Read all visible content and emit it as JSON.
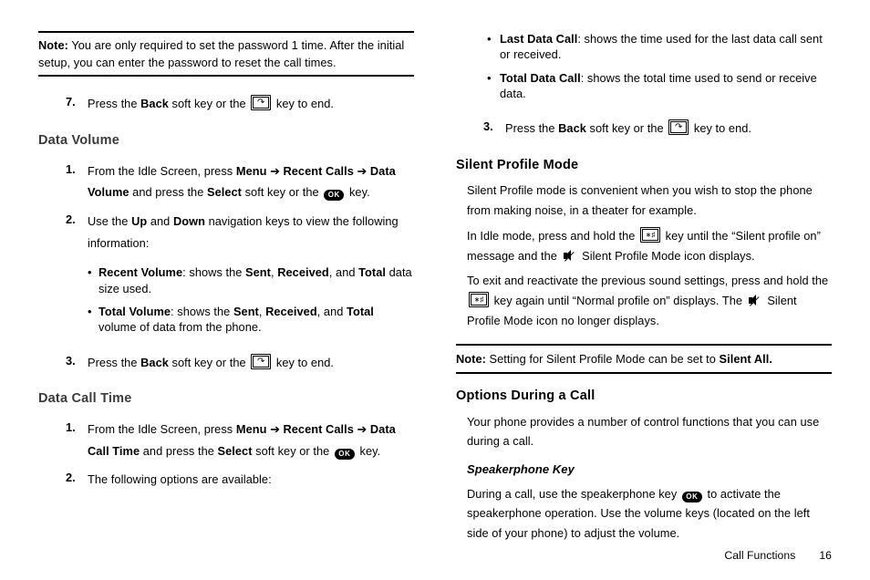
{
  "left": {
    "note1": {
      "label": "Note:",
      "text": " You are only required to set the password 1 time. After the initial setup, you can enter the password to reset the call times."
    },
    "step7": {
      "pre": "Press the ",
      "back": "Back",
      "mid": " soft key or the ",
      "post": " key to end."
    },
    "dataVolume": {
      "heading": "Data Volume",
      "s1": {
        "pre": "From the Idle Screen, press ",
        "menu": "Menu",
        "arrow1": " ➔ ",
        "recent": "Recent Calls",
        "arrow2": " ➔ ",
        "dv": "Data Volume",
        "mid": " and press the ",
        "select": "Select",
        "mid2": " soft key or the ",
        "post": " key."
      },
      "s2": {
        "pre": "Use the ",
        "up": "Up",
        "and": " and ",
        "down": "Down",
        "post": " navigation keys to view the following information:"
      },
      "b1": {
        "t": "Recent Volume",
        "rest_a": ": shows the ",
        "sent": "Sent",
        "c1": ", ",
        "rcvd": "Received",
        "c2": ", and ",
        "total": "Total",
        "rest_b": " data size used."
      },
      "b2": {
        "t": "Total Volume",
        "rest_a": ": shows the ",
        "sent": "Sent",
        "c1": ", ",
        "rcvd": "Received",
        "c2": ", and ",
        "total": "Total",
        "rest_b": " volume of data from the phone."
      },
      "s3": {
        "pre": "Press the ",
        "back": "Back",
        "mid": " soft key or the ",
        "post": " key to end."
      }
    },
    "dataCallTime": {
      "heading": "Data Call Time",
      "s1": {
        "pre": "From the Idle Screen, press ",
        "menu": "Menu",
        "arrow1": " ➔ ",
        "recent": "Recent Calls",
        "arrow2": " ➔ ",
        "dct": "Data Call Time",
        "mid": " and press the ",
        "select": "Select",
        "mid2": " soft key or the ",
        "post": " key."
      },
      "s2": "The following options are available:"
    }
  },
  "right": {
    "b1": {
      "t": "Last Data Call",
      "rest": ": shows the time used for the last data call sent or received."
    },
    "b2": {
      "t": "Total Data Call",
      "rest": ": shows the total time used to send or receive data."
    },
    "s3": {
      "pre": "Press the ",
      "back": "Back",
      "mid": " soft key or the ",
      "post": " key to end."
    },
    "silent": {
      "heading": "Silent Profile Mode",
      "p1": "Silent Profile mode is convenient when you wish to stop the phone from making noise, in a theater for example.",
      "p2a": "In Idle mode, press and hold the ",
      "p2b": " key until the “Silent profile on” message and the ",
      "p2c": " Silent Profile Mode icon displays.",
      "p3a": "To exit and reactivate the previous sound settings, press and hold the ",
      "p3b": " key again until “Normal profile on” displays. The ",
      "p3c": " Silent Profile Mode icon no longer displays."
    },
    "note2": {
      "label": "Note:",
      "pre": " Setting for Silent Profile Mode can be set to ",
      "b": "Silent All."
    },
    "options": {
      "heading": "Options During a Call",
      "p1": "Your phone provides a number of control functions that you can use during a call.",
      "sub": "Speakerphone Key",
      "p2a": "During a call, use the speakerphone key ",
      "p2b": " to activate the speakerphone operation. Use the volume keys (located on the left side of your phone) to adjust the volume."
    }
  },
  "icons": {
    "end": "↷",
    "ok": "OK",
    "hash": "∗♯"
  },
  "footer": {
    "section": "Call Functions",
    "page": "16"
  }
}
